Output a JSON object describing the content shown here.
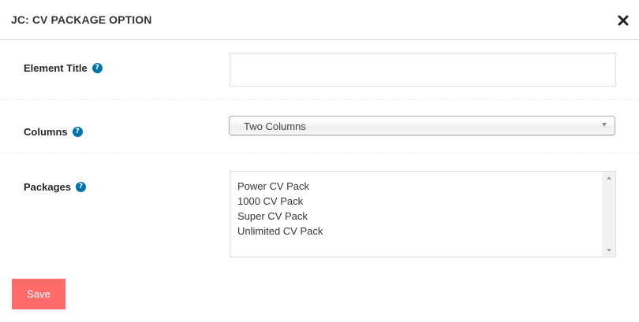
{
  "header": {
    "title": "JC: CV PACKAGE OPTION",
    "close_icon": "close-icon"
  },
  "fields": {
    "element_title": {
      "label": "Element Title",
      "value": "",
      "placeholder": "",
      "help_icon": "help-icon"
    },
    "columns": {
      "label": "Columns",
      "selected": "Two Columns",
      "help_icon": "help-icon"
    },
    "packages": {
      "label": "Packages",
      "help_icon": "help-icon",
      "options": [
        "Power CV Pack",
        "1000 CV Pack",
        "Super CV Pack",
        "Unlimited CV Pack"
      ]
    }
  },
  "actions": {
    "save_label": "Save"
  },
  "colors": {
    "accent": "#ff6b6b",
    "help_icon": "#0073aa"
  }
}
